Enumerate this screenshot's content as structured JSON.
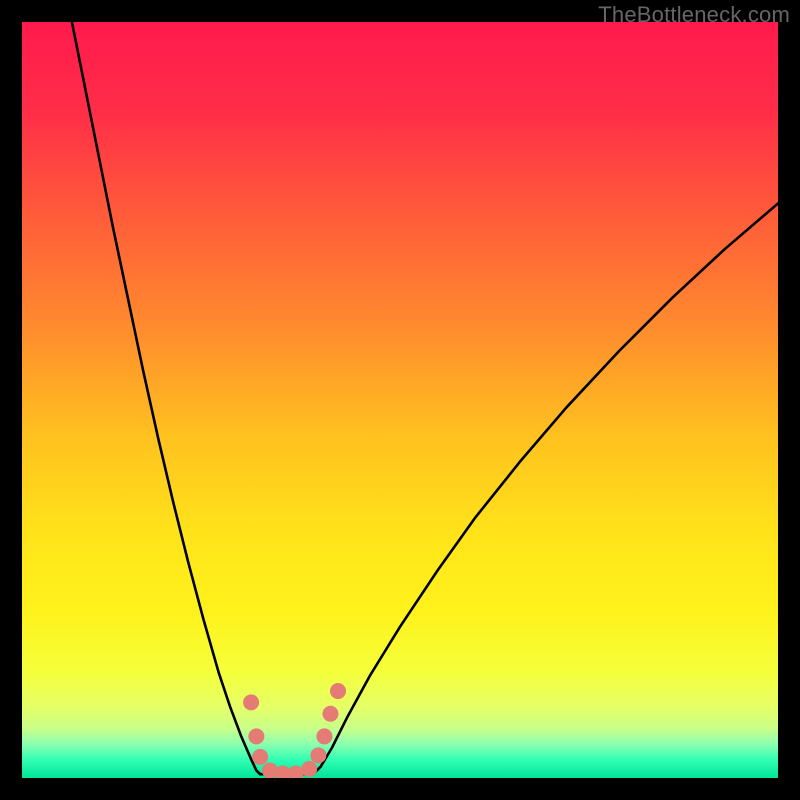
{
  "watermark": "TheBottleneck.com",
  "chart_data": {
    "type": "line",
    "title": "",
    "xlabel": "",
    "ylabel": "",
    "xlim": [
      0,
      100
    ],
    "ylim": [
      0,
      100
    ],
    "grid": false,
    "background_gradient": {
      "stops": [
        {
          "offset": 0.0,
          "color": "#ff1a4d"
        },
        {
          "offset": 0.12,
          "color": "#ff2e48"
        },
        {
          "offset": 0.25,
          "color": "#ff5a3a"
        },
        {
          "offset": 0.4,
          "color": "#ff8a2e"
        },
        {
          "offset": 0.55,
          "color": "#ffc21f"
        },
        {
          "offset": 0.68,
          "color": "#ffe41a"
        },
        {
          "offset": 0.78,
          "color": "#fff21c"
        },
        {
          "offset": 0.86,
          "color": "#f4ff3a"
        },
        {
          "offset": 0.905,
          "color": "#e6ff66"
        },
        {
          "offset": 0.935,
          "color": "#c8ff8a"
        },
        {
          "offset": 0.955,
          "color": "#8dffb0"
        },
        {
          "offset": 0.975,
          "color": "#33ffb3"
        },
        {
          "offset": 1.0,
          "color": "#00e59b"
        }
      ]
    },
    "series": [
      {
        "name": "left-curve",
        "style": "black-line",
        "x": [
          6.6,
          8,
          10,
          12,
          14,
          16,
          18,
          20,
          22,
          24,
          26,
          27.5,
          29,
          30.3,
          31,
          31.5
        ],
        "y": [
          100,
          93,
          83,
          73,
          63.5,
          54,
          45,
          36.5,
          28.5,
          21,
          14,
          9.5,
          5.5,
          2.5,
          1,
          0.5
        ]
      },
      {
        "name": "right-curve",
        "style": "black-line",
        "x": [
          38.5,
          39.5,
          41,
          43,
          46,
          50,
          55,
          60,
          66,
          72,
          79,
          86,
          93,
          100
        ],
        "y": [
          0.5,
          1.5,
          4,
          8,
          13.5,
          20,
          27.5,
          34.5,
          42,
          49,
          56.5,
          63.5,
          70,
          76
        ]
      },
      {
        "name": "floor",
        "style": "black-line",
        "x": [
          31.5,
          38.5
        ],
        "y": [
          0.5,
          0.5
        ]
      }
    ],
    "markers": {
      "name": "data-points",
      "color": "#e47b74",
      "radius": 8,
      "points": [
        {
          "x": 30.3,
          "y": 10.0
        },
        {
          "x": 31.0,
          "y": 5.5
        },
        {
          "x": 31.5,
          "y": 2.8
        },
        {
          "x": 32.8,
          "y": 1.0
        },
        {
          "x": 34.5,
          "y": 0.6
        },
        {
          "x": 36.2,
          "y": 0.6
        },
        {
          "x": 38.0,
          "y": 1.2
        },
        {
          "x": 39.2,
          "y": 3.0
        },
        {
          "x": 40.0,
          "y": 5.5
        },
        {
          "x": 40.8,
          "y": 8.5
        },
        {
          "x": 41.8,
          "y": 11.5
        }
      ]
    }
  }
}
